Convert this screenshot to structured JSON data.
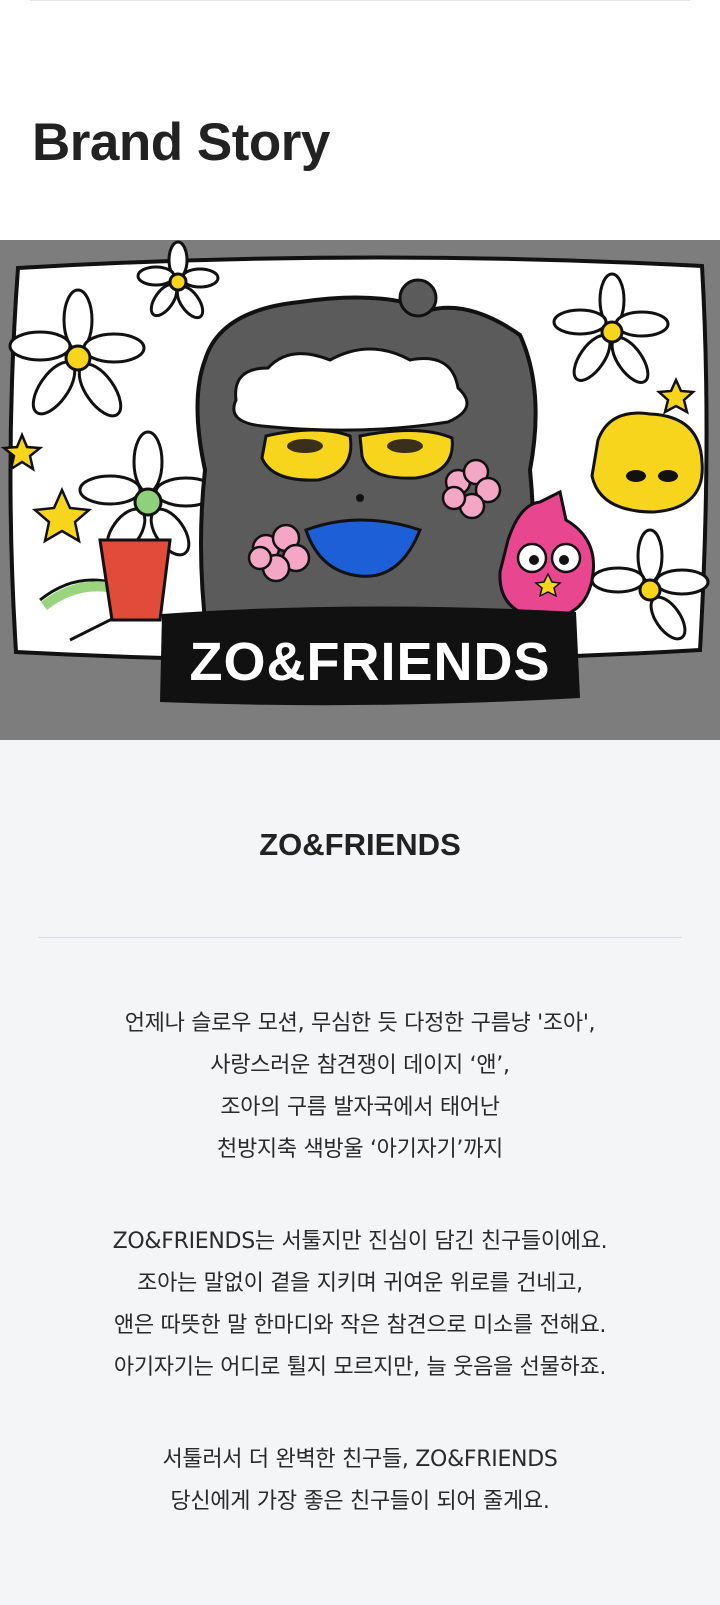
{
  "header": {
    "title": "Brand Story"
  },
  "banner": {
    "logo_text": "ZO&FRIENDS"
  },
  "story": {
    "title": "ZO&FRIENDS",
    "paragraphs": [
      [
        "언제나 슬로우 모션, 무심한 듯 다정한 구름냥 '조아',",
        "사랑스러운 참견쟁이 데이지 ‘앤’,",
        "조아의 구름 발자국에서 태어난",
        "천방지축 색방울 ‘아기자기’까지"
      ],
      [
        "ZO&FRIENDS는 서툴지만 진심이 담긴 친구들이에요.",
        "조아는 말없이 곁을 지키며 귀여운 위로를 건네고,",
        "앤은 따뜻한 말 한마디와 작은 참견으로 미소를 전해요.",
        "아기자기는 어디로 튈지 모르지만, 늘 웃음을 선물하죠."
      ],
      [
        "서툴러서 더 완벽한 친구들, ZO&FRIENDS",
        "당신에게 가장 좋은 친구들이 되어 줄게요."
      ]
    ]
  },
  "colors": {
    "banner_bg": "#7d7d7d",
    "story_bg": "#f4f5f7",
    "yellow": "#f7d51d",
    "pink": "#e8478f",
    "blue": "#1d5fd6"
  }
}
